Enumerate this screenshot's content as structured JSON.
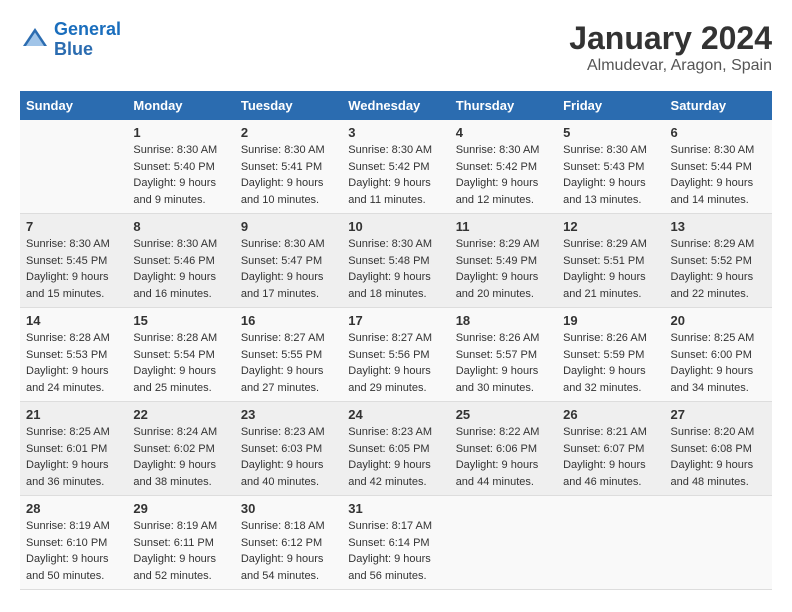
{
  "logo": {
    "line1": "General",
    "line2": "Blue"
  },
  "title": "January 2024",
  "subtitle": "Almudevar, Aragon, Spain",
  "days_of_week": [
    "Sunday",
    "Monday",
    "Tuesday",
    "Wednesday",
    "Thursday",
    "Friday",
    "Saturday"
  ],
  "weeks": [
    [
      {
        "day": "",
        "sunrise": "",
        "sunset": "",
        "daylight": ""
      },
      {
        "day": "1",
        "sunrise": "Sunrise: 8:30 AM",
        "sunset": "Sunset: 5:40 PM",
        "daylight": "Daylight: 9 hours and 9 minutes."
      },
      {
        "day": "2",
        "sunrise": "Sunrise: 8:30 AM",
        "sunset": "Sunset: 5:41 PM",
        "daylight": "Daylight: 9 hours and 10 minutes."
      },
      {
        "day": "3",
        "sunrise": "Sunrise: 8:30 AM",
        "sunset": "Sunset: 5:42 PM",
        "daylight": "Daylight: 9 hours and 11 minutes."
      },
      {
        "day": "4",
        "sunrise": "Sunrise: 8:30 AM",
        "sunset": "Sunset: 5:42 PM",
        "daylight": "Daylight: 9 hours and 12 minutes."
      },
      {
        "day": "5",
        "sunrise": "Sunrise: 8:30 AM",
        "sunset": "Sunset: 5:43 PM",
        "daylight": "Daylight: 9 hours and 13 minutes."
      },
      {
        "day": "6",
        "sunrise": "Sunrise: 8:30 AM",
        "sunset": "Sunset: 5:44 PM",
        "daylight": "Daylight: 9 hours and 14 minutes."
      }
    ],
    [
      {
        "day": "7",
        "sunrise": "Sunrise: 8:30 AM",
        "sunset": "Sunset: 5:45 PM",
        "daylight": "Daylight: 9 hours and 15 minutes."
      },
      {
        "day": "8",
        "sunrise": "Sunrise: 8:30 AM",
        "sunset": "Sunset: 5:46 PM",
        "daylight": "Daylight: 9 hours and 16 minutes."
      },
      {
        "day": "9",
        "sunrise": "Sunrise: 8:30 AM",
        "sunset": "Sunset: 5:47 PM",
        "daylight": "Daylight: 9 hours and 17 minutes."
      },
      {
        "day": "10",
        "sunrise": "Sunrise: 8:30 AM",
        "sunset": "Sunset: 5:48 PM",
        "daylight": "Daylight: 9 hours and 18 minutes."
      },
      {
        "day": "11",
        "sunrise": "Sunrise: 8:29 AM",
        "sunset": "Sunset: 5:49 PM",
        "daylight": "Daylight: 9 hours and 20 minutes."
      },
      {
        "day": "12",
        "sunrise": "Sunrise: 8:29 AM",
        "sunset": "Sunset: 5:51 PM",
        "daylight": "Daylight: 9 hours and 21 minutes."
      },
      {
        "day": "13",
        "sunrise": "Sunrise: 8:29 AM",
        "sunset": "Sunset: 5:52 PM",
        "daylight": "Daylight: 9 hours and 22 minutes."
      }
    ],
    [
      {
        "day": "14",
        "sunrise": "Sunrise: 8:28 AM",
        "sunset": "Sunset: 5:53 PM",
        "daylight": "Daylight: 9 hours and 24 minutes."
      },
      {
        "day": "15",
        "sunrise": "Sunrise: 8:28 AM",
        "sunset": "Sunset: 5:54 PM",
        "daylight": "Daylight: 9 hours and 25 minutes."
      },
      {
        "day": "16",
        "sunrise": "Sunrise: 8:27 AM",
        "sunset": "Sunset: 5:55 PM",
        "daylight": "Daylight: 9 hours and 27 minutes."
      },
      {
        "day": "17",
        "sunrise": "Sunrise: 8:27 AM",
        "sunset": "Sunset: 5:56 PM",
        "daylight": "Daylight: 9 hours and 29 minutes."
      },
      {
        "day": "18",
        "sunrise": "Sunrise: 8:26 AM",
        "sunset": "Sunset: 5:57 PM",
        "daylight": "Daylight: 9 hours and 30 minutes."
      },
      {
        "day": "19",
        "sunrise": "Sunrise: 8:26 AM",
        "sunset": "Sunset: 5:59 PM",
        "daylight": "Daylight: 9 hours and 32 minutes."
      },
      {
        "day": "20",
        "sunrise": "Sunrise: 8:25 AM",
        "sunset": "Sunset: 6:00 PM",
        "daylight": "Daylight: 9 hours and 34 minutes."
      }
    ],
    [
      {
        "day": "21",
        "sunrise": "Sunrise: 8:25 AM",
        "sunset": "Sunset: 6:01 PM",
        "daylight": "Daylight: 9 hours and 36 minutes."
      },
      {
        "day": "22",
        "sunrise": "Sunrise: 8:24 AM",
        "sunset": "Sunset: 6:02 PM",
        "daylight": "Daylight: 9 hours and 38 minutes."
      },
      {
        "day": "23",
        "sunrise": "Sunrise: 8:23 AM",
        "sunset": "Sunset: 6:03 PM",
        "daylight": "Daylight: 9 hours and 40 minutes."
      },
      {
        "day": "24",
        "sunrise": "Sunrise: 8:23 AM",
        "sunset": "Sunset: 6:05 PM",
        "daylight": "Daylight: 9 hours and 42 minutes."
      },
      {
        "day": "25",
        "sunrise": "Sunrise: 8:22 AM",
        "sunset": "Sunset: 6:06 PM",
        "daylight": "Daylight: 9 hours and 44 minutes."
      },
      {
        "day": "26",
        "sunrise": "Sunrise: 8:21 AM",
        "sunset": "Sunset: 6:07 PM",
        "daylight": "Daylight: 9 hours and 46 minutes."
      },
      {
        "day": "27",
        "sunrise": "Sunrise: 8:20 AM",
        "sunset": "Sunset: 6:08 PM",
        "daylight": "Daylight: 9 hours and 48 minutes."
      }
    ],
    [
      {
        "day": "28",
        "sunrise": "Sunrise: 8:19 AM",
        "sunset": "Sunset: 6:10 PM",
        "daylight": "Daylight: 9 hours and 50 minutes."
      },
      {
        "day": "29",
        "sunrise": "Sunrise: 8:19 AM",
        "sunset": "Sunset: 6:11 PM",
        "daylight": "Daylight: 9 hours and 52 minutes."
      },
      {
        "day": "30",
        "sunrise": "Sunrise: 8:18 AM",
        "sunset": "Sunset: 6:12 PM",
        "daylight": "Daylight: 9 hours and 54 minutes."
      },
      {
        "day": "31",
        "sunrise": "Sunrise: 8:17 AM",
        "sunset": "Sunset: 6:14 PM",
        "daylight": "Daylight: 9 hours and 56 minutes."
      },
      {
        "day": "",
        "sunrise": "",
        "sunset": "",
        "daylight": ""
      },
      {
        "day": "",
        "sunrise": "",
        "sunset": "",
        "daylight": ""
      },
      {
        "day": "",
        "sunrise": "",
        "sunset": "",
        "daylight": ""
      }
    ]
  ]
}
